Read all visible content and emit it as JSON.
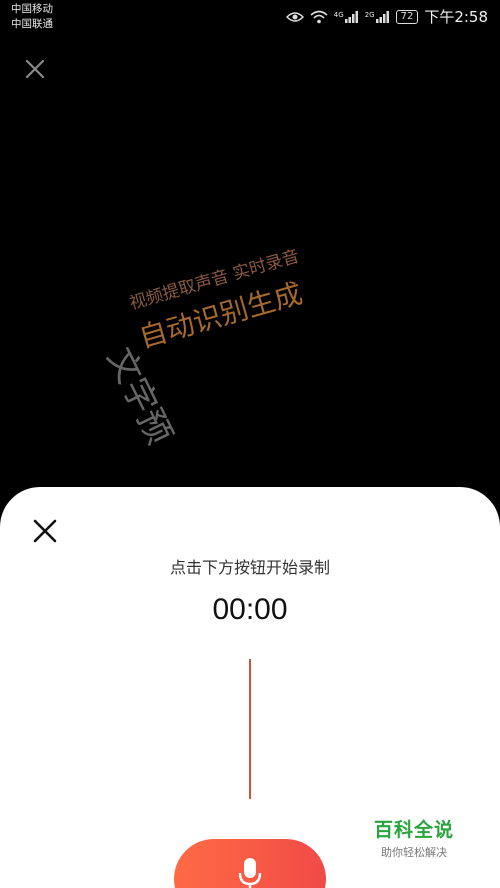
{
  "status_bar": {
    "carrier_1": "中国移动",
    "carrier_2": "中国联通",
    "signal_1_label": "4G",
    "signal_2_label": "2G",
    "battery": "72",
    "time": "下午2:58"
  },
  "top_bar": {
    "close_icon": "close-icon"
  },
  "watermark": {
    "line1": "视频提取声音 实时录音",
    "line2": "自动识别生成",
    "line3": "文字预"
  },
  "recorder": {
    "instruction": "点击下方按钮开始录制",
    "timer": "00:00",
    "accent_color": "#f35b46",
    "waveform_color": "#c8553a",
    "mic_icon": "microphone-icon"
  },
  "site_logo": {
    "title": "百科全说",
    "subtitle": "助你轻松解决"
  }
}
